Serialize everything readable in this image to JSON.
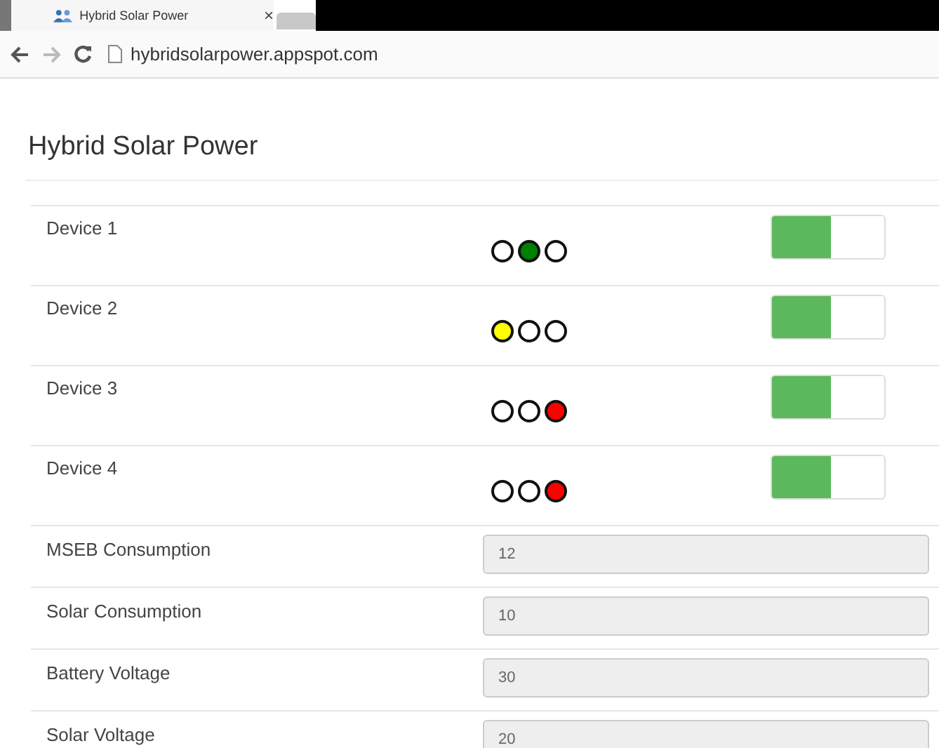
{
  "browser": {
    "tab_title": "Hybrid Solar Power",
    "tab_close": "×",
    "url": "hybridsolarpower.appspot.com"
  },
  "page_title": "Hybrid Solar Power",
  "devices": [
    {
      "name": "Device 1",
      "on": true,
      "lights": [
        {
          "lit": false
        },
        {
          "lit": true,
          "color": "#008000"
        },
        {
          "lit": false
        }
      ]
    },
    {
      "name": "Device 2",
      "on": true,
      "lights": [
        {
          "lit": true,
          "color": "#ffff00"
        },
        {
          "lit": false
        },
        {
          "lit": false
        }
      ]
    },
    {
      "name": "Device 3",
      "on": true,
      "lights": [
        {
          "lit": false
        },
        {
          "lit": false
        },
        {
          "lit": true,
          "color": "#ff0000"
        }
      ]
    },
    {
      "name": "Device 4",
      "on": true,
      "lights": [
        {
          "lit": false
        },
        {
          "lit": false
        },
        {
          "lit": true,
          "color": "#ff0000"
        }
      ]
    }
  ],
  "readings": [
    {
      "label": "MSEB Consumption",
      "value": "12"
    },
    {
      "label": "Solar Consumption",
      "value": "10"
    },
    {
      "label": "Battery Voltage",
      "value": "30"
    },
    {
      "label": "Solar Voltage",
      "value": "20"
    }
  ]
}
